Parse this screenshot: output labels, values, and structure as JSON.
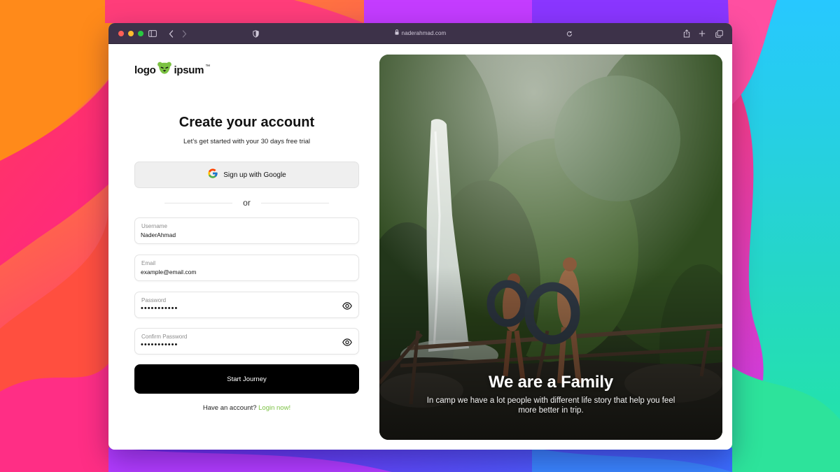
{
  "browser": {
    "url": "naderahmad.com"
  },
  "logo": {
    "text_left": "logo",
    "text_right": "ipsum",
    "mark": "™",
    "accent": "#7cc243"
  },
  "form": {
    "title": "Create your account",
    "subtitle": "Let’s get started with your 30 days free trial",
    "google_button": "Sign up with Google",
    "divider": "or",
    "fields": [
      {
        "label": "Username",
        "value": "NaderAhmad"
      },
      {
        "label": "Email",
        "value": "example@email.com"
      },
      {
        "label": "Password",
        "value": "•••••••••••"
      },
      {
        "label": "Confirm Password",
        "value": "•••••••••••"
      }
    ],
    "submit": "Start Journey",
    "login_prompt": "Have an account?",
    "login_link": "Login now!"
  },
  "hero": {
    "title": "We are a Family",
    "description": "In camp we have a lot people with different life story that help you feel more better in trip."
  },
  "icons": {
    "titlebar": [
      "sidebar-icon",
      "back-icon",
      "forward-icon",
      "shield-icon",
      "lock-icon",
      "reload-icon",
      "share-icon",
      "new-tab-icon",
      "tabs-icon"
    ],
    "google": "google-icon",
    "password_toggle": "eye-icon"
  }
}
